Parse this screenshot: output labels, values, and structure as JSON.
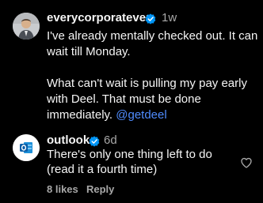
{
  "comments": [
    {
      "username": "everycorporatever",
      "time": "1w",
      "lines": [
        "I've already mentally checked out. It can",
        "wait till Monday.",
        "",
        "What can't wait is pulling my pay early",
        "with Deel. That must be done",
        "immediately."
      ],
      "mention": "@getdeel",
      "avatar_icon": "person-avatar-icon"
    },
    {
      "username": "outlook",
      "time": "6d",
      "lines": [
        "There's only one thing left to do",
        "(read it a fourth time)"
      ],
      "likes": "8 likes",
      "reply_label": "Reply",
      "avatar_icon": "outlook-logo-icon"
    }
  ],
  "colors": {
    "background": "#000000",
    "text": "#f5f5f5",
    "muted": "#a8a8a8",
    "verified": "#0095f6",
    "mention": "#4f8cff"
  }
}
